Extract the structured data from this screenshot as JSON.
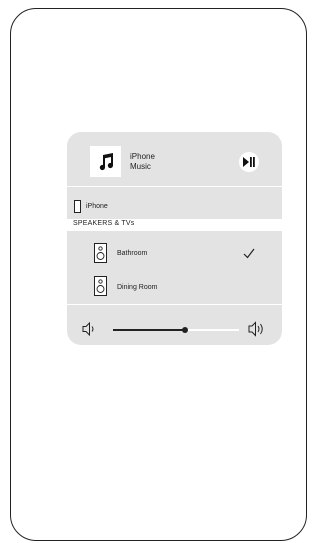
{
  "now_playing": {
    "device": "iPhone",
    "app": "Music",
    "album_art_icon": "music-note-icon",
    "play_pause_icon": "play-pause-icon"
  },
  "current_output": {
    "label": "iPhone",
    "icon": "iphone-icon"
  },
  "section_header": "SPEAKERS & TVs",
  "speakers": [
    {
      "label": "Bathroom",
      "selected": true,
      "icon": "speaker-icon"
    },
    {
      "label": "Dining Room",
      "selected": false,
      "icon": "speaker-icon"
    }
  ],
  "volume": {
    "level": 0.57,
    "low_icon": "volume-low-icon",
    "high_icon": "volume-high-icon"
  },
  "colors": {
    "card_bg": "#e3e3e3",
    "foreground": "#222222",
    "background": "#ffffff"
  }
}
